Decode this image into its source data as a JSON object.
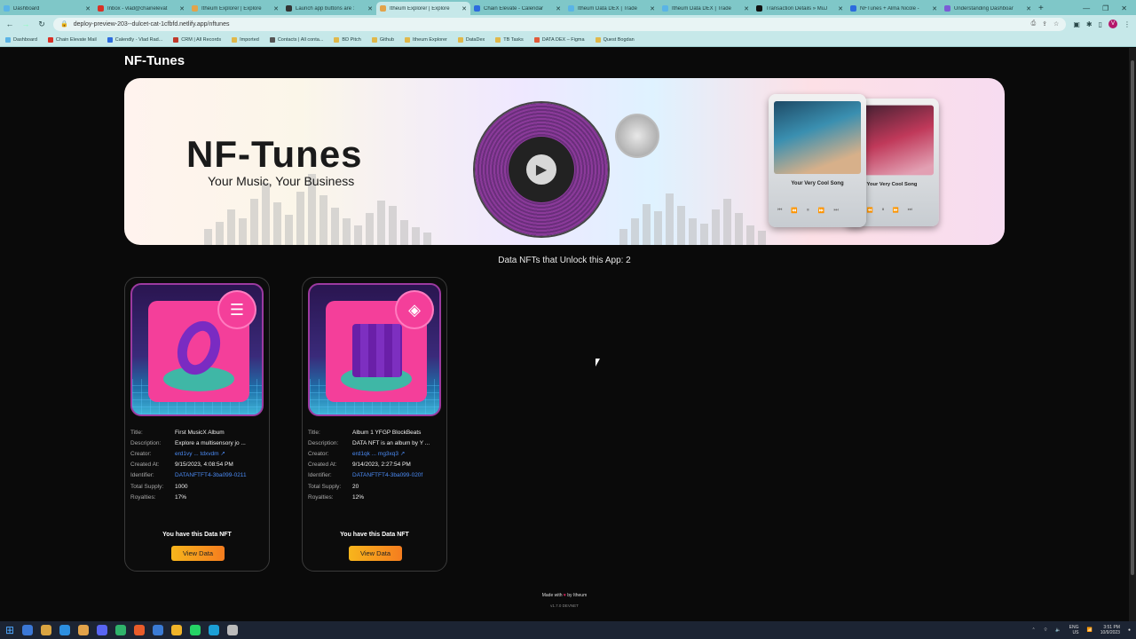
{
  "browser": {
    "tabs": [
      {
        "title": "Dashboard",
        "color": "#5ab4e6"
      },
      {
        "title": "Inbox - vlad@chainelevat",
        "color": "#d93025"
      },
      {
        "title": "Itheum Explorer | Explore",
        "color": "#e2a34a"
      },
      {
        "title": "Launch app buttons are :",
        "color": "#333333"
      },
      {
        "title": "Itheum Explorer | Explore",
        "color": "#e2a34a"
      },
      {
        "title": "Chain Elevate - Calendar",
        "color": "#2c6bde"
      },
      {
        "title": "Itheum Data DEX | Trade",
        "color": "#5ab4e6"
      },
      {
        "title": "Itheum Data DEX | Trade",
        "color": "#5ab4e6"
      },
      {
        "title": "Transaction Details » MuJ",
        "color": "#111111"
      },
      {
        "title": "NFTunes + Alma Nicole -",
        "color": "#2c6bde"
      },
      {
        "title": "Understanding Dashboar",
        "color": "#7b5cd6"
      }
    ],
    "active_tab_index": 4,
    "url": "deploy-preview-203--dulcet-cat-1cfbfd.netlify.app/nftunes",
    "profile_initial": "V",
    "bookmarks": [
      {
        "label": "Dashboard",
        "color": "#5ab4e6"
      },
      {
        "label": "Chain Elevate Mail",
        "color": "#d93025"
      },
      {
        "label": "Calendly - Vlad Rad...",
        "color": "#2c6bde"
      },
      {
        "label": "CRM | All Records",
        "color": "#c0392b"
      },
      {
        "label": "Imported",
        "color": "#e0b84a"
      },
      {
        "label": "Contacts | All conta...",
        "color": "#555555"
      },
      {
        "label": "BD Pitch",
        "color": "#e0b84a"
      },
      {
        "label": "Github",
        "color": "#e0b84a"
      },
      {
        "label": "Itheum Explorer",
        "color": "#e0b84a"
      },
      {
        "label": "DataDex",
        "color": "#e0b84a"
      },
      {
        "label": "TB Tasks",
        "color": "#e0b84a"
      },
      {
        "label": "DATA DEX – Figma",
        "color": "#e05a3a"
      },
      {
        "label": "Quest Bogdan",
        "color": "#e0b84a"
      }
    ]
  },
  "page": {
    "title": "NF-Tunes",
    "banner_title": "NF-Tunes",
    "banner_subtitle": "Your Music, Your Business",
    "phone_song": "Your Very Cool Song",
    "unlock_text": "Data NFTs that Unlock this App: 2",
    "field_labels": {
      "title": "Title:",
      "description": "Description:",
      "creator": "Creator:",
      "created_at": "Created At:",
      "identifier": "Identifier:",
      "total_supply": "Total Supply:",
      "royalties": "Royalties:"
    },
    "cards": [
      {
        "title": "First MusicX Album",
        "description": "Explore a multisensory jo ...",
        "creator": "erd1vy ... tdxvdm",
        "created_at": "9/15/2023, 4:08:54 PM",
        "identifier": "DATANFTFT4-3ba099-0211",
        "total_supply": "1000",
        "royalties": "17%",
        "ownership": "You have this Data NFT",
        "button": "View Data"
      },
      {
        "title": "Album 1 YFGP BlockBeats",
        "description": "DATA NFT is an album by Y ...",
        "creator": "erd1qk ... mg3xq3",
        "created_at": "9/14/2023, 2:27:54 PM",
        "identifier": "DATANFTFT4-3ba099-020f",
        "total_supply": "20",
        "royalties": "12%",
        "ownership": "You have this Data NFT",
        "button": "View Data"
      }
    ],
    "footer_made": "Made with",
    "footer_by": "by Itheum",
    "footer_version": "v1.7.0 DEVNET"
  },
  "taskbar": {
    "lang": "ENG",
    "region": "US",
    "time": "3:51 PM",
    "date": "10/9/2023"
  },
  "colors": {
    "accent_orange": "#f7b51c",
    "link_blue": "#4b8bf5",
    "tab_strip": "#7fc7c8"
  }
}
